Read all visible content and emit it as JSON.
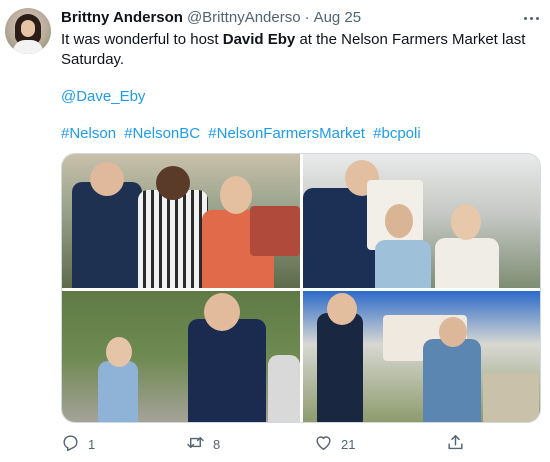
{
  "tweet": {
    "author_name": "Brittny Anderson",
    "author_handle": "@BrittnyAnderso",
    "separator": "·",
    "date": "Aug 25",
    "text_before": "It was wonderful to host ",
    "text_bold": "David Eby",
    "text_after": " at the Nelson Farmers Market last Saturday.",
    "mention": "@Dave_Eby",
    "hashtags": [
      "#Nelson",
      "#NelsonBC",
      "#NelsonFarmersMarket",
      "#bcpoli"
    ]
  },
  "actions": {
    "reply_count": "1",
    "retweet_count": "8",
    "like_count": "21"
  },
  "icons": {
    "more": "more-icon",
    "reply": "reply-icon",
    "retweet": "retweet-icon",
    "like": "heart-icon",
    "share": "share-icon"
  },
  "colors": {
    "link": "#1d9bf0",
    "secondary_text": "#536471",
    "primary_text": "#0f1419",
    "border": "#cfd9de"
  }
}
